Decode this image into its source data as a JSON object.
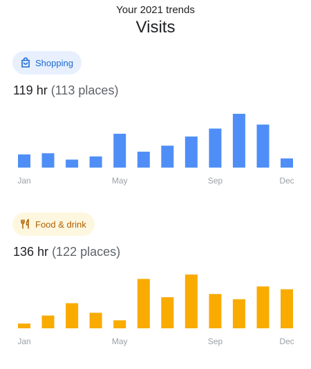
{
  "header": {
    "subtitle": "Your 2021 trends",
    "title": "Visits"
  },
  "sections": [
    {
      "category": "Shopping",
      "icon": "shopping-bag-icon",
      "chip_bg": "#e8f0fe",
      "chip_fg": "#1967d2",
      "bar_color": "#4f8ef7",
      "hours": "119 hr",
      "places": "(113 places)",
      "chart_data": {
        "type": "bar",
        "categories": [
          "Jan",
          "Feb",
          "Mar",
          "Apr",
          "May",
          "Jun",
          "Jul",
          "Aug",
          "Sep",
          "Oct",
          "Nov",
          "Dec"
        ],
        "tick_labels": [
          "Jan",
          "May",
          "Sep",
          "Dec"
        ],
        "values": [
          3.3,
          3.6,
          2.0,
          2.8,
          8.5,
          4.0,
          5.5,
          7.8,
          9.8,
          13.5,
          10.8,
          2.3
        ]
      }
    },
    {
      "category": "Food & drink",
      "icon": "fork-knife-icon",
      "chip_bg": "#fef7e0",
      "chip_fg": "#b06000",
      "bar_color": "#f9ab00",
      "hours": "136 hr",
      "places": "(122 places)",
      "chart_data": {
        "type": "bar",
        "categories": [
          "Jan",
          "Feb",
          "Mar",
          "Apr",
          "May",
          "Jun",
          "Jul",
          "Aug",
          "Sep",
          "Oct",
          "Nov",
          "Dec"
        ],
        "tick_labels": [
          "Jan",
          "May",
          "Sep",
          "Dec"
        ],
        "values": [
          1.2,
          3.2,
          6.3,
          3.9,
          2.0,
          12.4,
          7.8,
          13.5,
          8.6,
          7.3,
          10.5,
          9.8
        ]
      }
    }
  ]
}
